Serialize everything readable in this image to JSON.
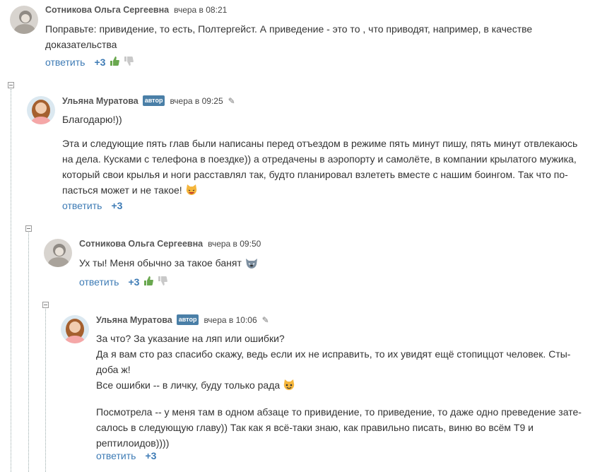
{
  "common": {
    "reply_label": "ответить",
    "badge_label": "автор"
  },
  "comments": [
    {
      "author": "Сотникова Ольга Сергеевна",
      "time": "вчера в 08:21",
      "score": "+3",
      "lines": [
        "Поправьте: привидение, то есть, Полтергейст. А приведение - это то , что приводят, например, в качестве доказательства"
      ]
    },
    {
      "author": "Ульяна Муратова",
      "time": "вчера в 09:25",
      "score": "+3",
      "p1": "Благодарю!))",
      "p2": "Эта и следующие пять глав были написаны перед отъездом в режиме пять минут пишу, пять минут отвлекаюсь на дела. Кусками с телефона в поездке)) а отредачены в аэропорту и самолёте, в компании крылатого мужика, который свои крылья и ноги расставлял так, будто планировал взлететь вместе с нашим боингом. Так что по-пасться может и не такое!"
    },
    {
      "author": "Сотникова Ольга Сергеевна",
      "time": "вчера в 09:50",
      "score": "+3",
      "p1": "Ух ты! Меня обычно за такое банят"
    },
    {
      "author": "Ульяна Муратова",
      "time": "вчера в 10:06",
      "score": "+3",
      "l1": "За что? За указание на ляп или ошибки?",
      "l2": "Да я вам сто раз спасибо скажу, ведь если их не исправить, то их увидят ещё стопиццот человек. Сты-доба ж!",
      "l3": "Все ошибки -- в личку, буду только рада",
      "p2": "Посмотрела -- у меня там в одном абзаце то привидение, то приведение, то даже одно преведение зате-салось в следующую главу)) Так как я всё-таки знаю, как правильно писать, виню во всём Т9 и рептилоидов))))"
    }
  ]
}
